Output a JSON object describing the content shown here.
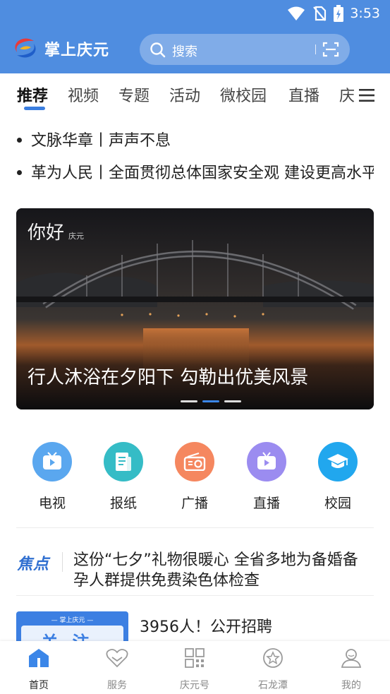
{
  "status_bar": {
    "time": "3:53"
  },
  "header": {
    "app_title": "掌上庆元",
    "search_placeholder": "搜索"
  },
  "tabs": [
    {
      "label": "推荐",
      "active": true
    },
    {
      "label": "视频"
    },
    {
      "label": "专题"
    },
    {
      "label": "活动"
    },
    {
      "label": "微校园"
    },
    {
      "label": "直播"
    },
    {
      "label": "庆"
    }
  ],
  "headlines": [
    "文脉华章丨声声不息",
    "革为人民丨全面贯彻总体国家安全观 建设更高水平平安中国"
  ],
  "banner": {
    "caption": "行人沐浴在夕阳下 勾勒出优美风景",
    "watermark": "你好",
    "watermark_small": "庆元",
    "slide_count": 3,
    "active_slide": 1
  },
  "quick_links": [
    {
      "label": "电视",
      "icon": "tv-icon",
      "color": "#5aa7ef"
    },
    {
      "label": "报纸",
      "icon": "newspaper-icon",
      "color": "#35bcc6"
    },
    {
      "label": "广播",
      "icon": "radio-icon",
      "color": "#f5875f"
    },
    {
      "label": "直播",
      "icon": "live-icon",
      "color": "#9b8cf0"
    },
    {
      "label": "校园",
      "icon": "graduation-cap-icon",
      "color": "#21a7ee"
    }
  ],
  "focus": {
    "tag": "焦点",
    "text": "这份“七夕”礼物很暖心 全省多地为备婚备孕人群提供免费染色体检查"
  },
  "news": [
    {
      "title": "3956人！公开招聘",
      "thumb_label": "— 掌上庆元 —",
      "thumb_text": "关注"
    }
  ],
  "bottom_nav": [
    {
      "label": "首页",
      "icon": "home-icon",
      "active": true
    },
    {
      "label": "服务",
      "icon": "heart-icon"
    },
    {
      "label": "庆元号",
      "icon": "grid-icon"
    },
    {
      "label": "石龙潭",
      "icon": "star-circle-icon"
    },
    {
      "label": "我的",
      "icon": "user-icon"
    }
  ],
  "colors": {
    "primary": "#4f8de0",
    "accent": "#3b7ee0"
  }
}
